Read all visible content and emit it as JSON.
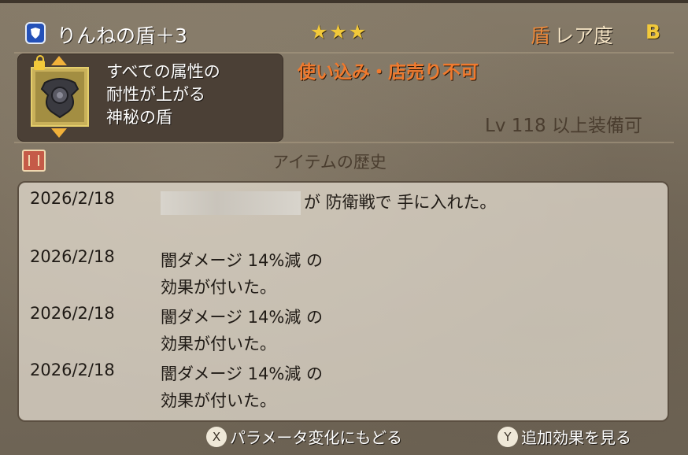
{
  "title_bar": {
    "item_name": "りんねの盾＋3",
    "stars": "★★★",
    "rarity_kanji": "盾",
    "rarity_label": "レア度",
    "rarity_grade": "B"
  },
  "description": {
    "lines": [
      "すべての属性の",
      "耐性が上がる",
      "神秘の盾"
    ]
  },
  "restriction": "使い込み・店売り不可",
  "level_requirement": "Lv 118 以上装備可",
  "history": {
    "heading": "アイテムの歴史",
    "entries": [
      {
        "date": "2026/2/18",
        "line1": "が 防衛戦で 手に入れた。",
        "line2": ""
      },
      {
        "date": "2026/2/18",
        "line1": "闇ダメージ 14%減 の",
        "line2": "効果が付いた。"
      },
      {
        "date": "2026/2/18",
        "line1": "闇ダメージ 14%減 の",
        "line2": "効果が付いた。"
      },
      {
        "date": "2026/2/18",
        "line1": "闇ダメージ 14%減 の",
        "line2": "効果が付いた。"
      }
    ]
  },
  "footer": {
    "x_button": "X",
    "x_label": "パラメータ変化にもどる",
    "y_button": "Y",
    "y_label": "追加効果を見る"
  },
  "colors": {
    "accent_gold": "#f2c93a",
    "warning_orange": "#f07a2e",
    "shield_blue": "#2451b8"
  },
  "icons": {
    "shield_badge": "shield-icon",
    "item": "mystic-shield-icon",
    "lock": "lock-icon",
    "book": "book-icon"
  }
}
